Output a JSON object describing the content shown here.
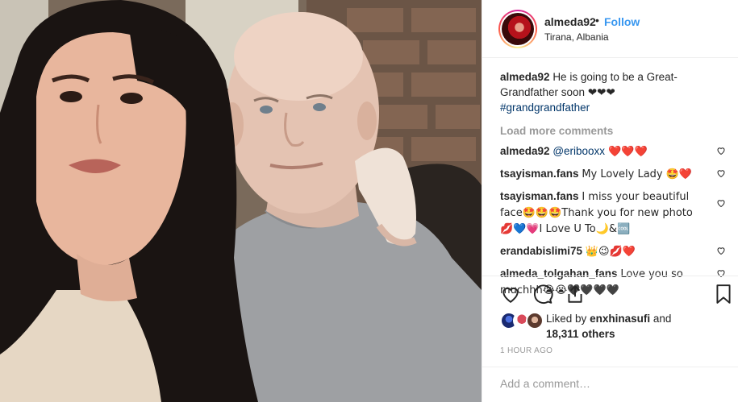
{
  "post": {
    "photo_alt": "Selfie of a young woman with long dark hair and an older bald man in a grey sweater"
  },
  "header": {
    "username": "almeda92",
    "separator": "•",
    "follow_label": "Follow",
    "location": "Tirana, Albania"
  },
  "caption": {
    "username": "almeda92",
    "text": "He is going to be a Great-Grandfather soon ❤❤❤",
    "hashtag": "#grandgrandfather"
  },
  "load_more_label": "Load more comments",
  "comments": [
    {
      "username": "almeda92",
      "mention": "@eribooxx",
      "text": " ❤️❤️❤️"
    },
    {
      "username": "tsayisman.fans",
      "text": "My Lovely Lady 🤩❤️"
    },
    {
      "username": "tsayisman.fans",
      "text": "I miss your beautiful face🤩🤩🤩Thank you for new photo 💋💙💗I Love U To🌙&🆒"
    },
    {
      "username": "erandabislimi75",
      "text": "👑😉💋❤️"
    },
    {
      "username": "almeda_tolgahan_fans",
      "text": "Love you so muchhh😭😭🖤🖤🖤🖤"
    }
  ],
  "likes": {
    "prefix": "Liked by",
    "user": "enxhinasufi",
    "middle": "and",
    "count": "18,311 others"
  },
  "timestamp": "1 HOUR AGO",
  "add_comment": {
    "placeholder": "Add a comment…"
  },
  "colors": {
    "link": "#3897f0",
    "hashtag": "#003569",
    "muted": "#999999",
    "border": "#efefef"
  }
}
